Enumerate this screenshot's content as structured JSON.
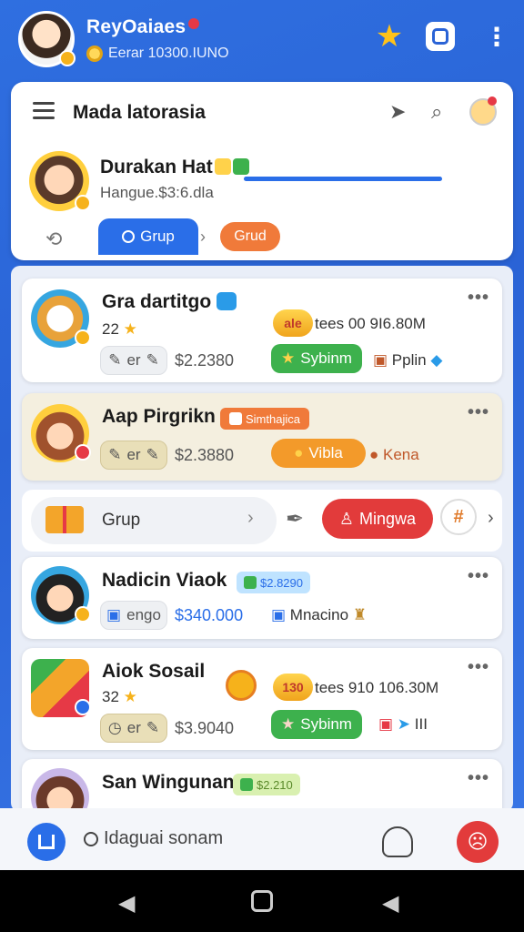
{
  "status": {
    "app_title": "ReyOaiaes",
    "balance": "Eerar 10300.IUNO"
  },
  "panel": {
    "title": "Mada latorasia",
    "profile_name": "Durakan Hat",
    "profile_sub": "Hangue.$3:6.dla",
    "tab_active": "Grup",
    "tab_other": "Grud"
  },
  "posts": [
    {
      "name": "Gra dartitgo",
      "level": "22",
      "chip_label": "er",
      "price": "$2.2380",
      "badge": "ale",
      "stat": "tees 00 9I6.80M",
      "action": "Sybinm",
      "extra": "Pplin"
    },
    {
      "name": "Aap Pirgrikn",
      "tag": "Simthajica",
      "chip_label": "er",
      "price": "$2.3880",
      "action": "Vibla",
      "extra": "Kena"
    },
    {
      "name": "Nadicin Viaok",
      "tag": "$2.8290",
      "chip_label": "engo",
      "price": "$340.000",
      "extra": "Mnacino"
    },
    {
      "name": "Aiok Sosail",
      "level": "32",
      "chip_label": "er",
      "price": "$3.9040",
      "badge": "130",
      "stat": "tees 910 106.30M",
      "action": "Sybinm",
      "extra": "III"
    },
    {
      "name": "San Wingunan",
      "tag": "$2.210"
    }
  ],
  "grup_row": {
    "label": "Grup",
    "mingwa": "Mingwa"
  },
  "bottom": {
    "search": "Idaguai sonam"
  },
  "colors": {
    "primary": "#2a6ee8",
    "accent_red": "#e23b3b",
    "green": "#3db14d",
    "orange": "#f07a3a"
  }
}
